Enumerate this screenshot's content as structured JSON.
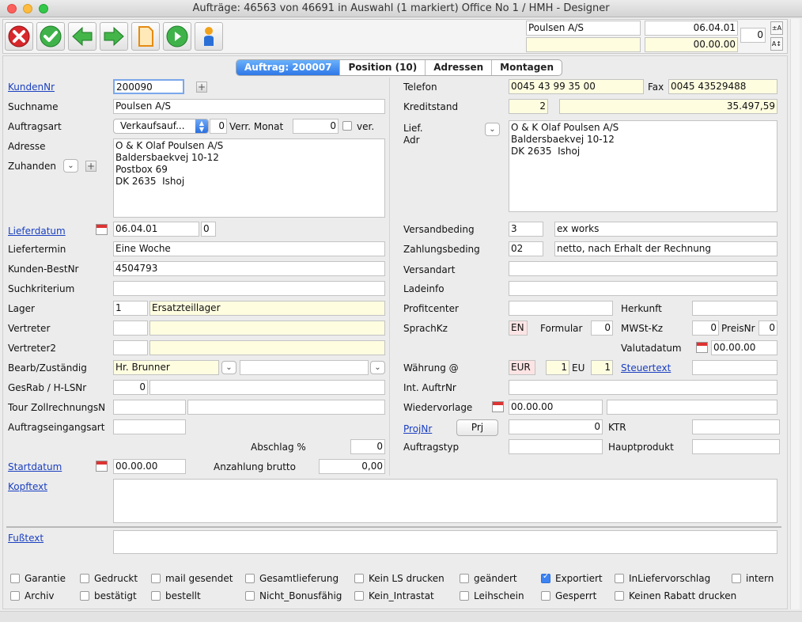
{
  "window": {
    "title": "Aufträge: 46563 von 46691 in Auswahl  (1 markiert) Office No 1 /  HMH - Designer"
  },
  "toolbar": {
    "customer": "Poulsen A/S",
    "date": "06.04.01",
    "amount": "00.00.00",
    "counter": "0",
    "buttons": [
      "cancel-icon",
      "confirm-icon",
      "back-arrow-icon",
      "forward-arrow-icon",
      "document-icon",
      "play-icon",
      "person-icon"
    ]
  },
  "tabs": [
    {
      "label": "Auftrag: 200007"
    },
    {
      "label": "Position (10)"
    },
    {
      "label": "Adressen"
    },
    {
      "label": "Montagen"
    }
  ],
  "left": {
    "kundennr_label": "KundenNr",
    "kundennr": "200090",
    "suchname_label": "Suchname",
    "suchname": "Poulsen A/S",
    "auftragsart_label": "Auftragsart",
    "auftragsart": "Verkaufsauf...",
    "auftragsart_num": "0",
    "verr_monat_label": "Verr. Monat",
    "verr_monat": "0",
    "ver_label": "ver.",
    "adresse_label": "Adresse",
    "zuhanden_label": "Zuhanden",
    "adresse": "O & K Olaf Poulsen A/S\nBaldersbaekvej 10-12\nPostbox 69\nDK 2635  Ishoj",
    "lieferdatum_label": "Lieferdatum",
    "lieferdatum": "06.04.01",
    "lieferdatum_num": "0",
    "liefertermin_label": "Liefertermin",
    "liefertermin": "Eine Woche",
    "bestnr_label": "Kunden-BestNr",
    "bestnr": "4504793",
    "suchkriterium_label": "Suchkriterium",
    "lager_label": "Lager",
    "lager": "1",
    "lager_name": "Ersatzteillager",
    "vertreter_label": "Vertreter",
    "vertreter2_label": "Vertreter2",
    "bearb_label": "Bearb/Zuständig",
    "bearb": "Hr. Brunner",
    "gesrab_label": "GesRab / H-LSNr",
    "gesrab": "0",
    "tour_label": "Tour  ZollrechnungsN",
    "eingangsart_label": "Auftragseingangsart",
    "abschlag_label": "Abschlag %",
    "abschlag": "0",
    "startdatum_label": "Startdatum",
    "startdatum": "00.00.00",
    "anzahlung_label": "Anzahlung brutto",
    "anzahlung": "0,00"
  },
  "right": {
    "telefon_label": "Telefon",
    "telefon": "0045 43 99 35 00",
    "fax_label": "Fax",
    "fax": "0045 43529488",
    "kreditstand_label": "Kreditstand",
    "kreditstand": "2",
    "kredit_betrag": "35.497,59",
    "lief_label": "Lief.",
    "adr_label": "Adr",
    "lief_adresse": "O & K Olaf Poulsen A/S\nBaldersbaekvej 10-12\nDK 2635  Ishoj",
    "versandbeding_label": "Versandbeding",
    "versandbeding": "3",
    "versandbeding_text": "ex works",
    "zahlungsbeding_label": "Zahlungsbeding",
    "zahlungsbeding": "02",
    "zahlungsbeding_text": "netto, nach Erhalt  der Rechnung",
    "versandart_label": "Versandart",
    "ladeinfo_label": "Ladeinfo",
    "profitcenter_label": "Profitcenter",
    "herkunft_label": "Herkunft",
    "sprachkz_label": "SprachKz",
    "sprachkz": "EN",
    "formular_label": "Formular",
    "formular": "0",
    "mwst_label": "MWSt-Kz",
    "mwst": "0",
    "preisnr_label": "PreisNr",
    "preisnr": "0",
    "valutadatum_label": "Valutadatum",
    "valutadatum": "00.00.00",
    "waehrung_label": "Währung @",
    "waehrung": "EUR",
    "waehrung_num": "1",
    "eu_label": "EU",
    "eu": "1",
    "steuertext_label": "Steuertext",
    "int_auftrnr_label": "Int. AuftrNr",
    "wiedervorlage_label": "Wiedervorlage",
    "wiedervorlage": "00.00.00",
    "projnr_label": "ProjNr",
    "prj_button": "Prj",
    "projnr": "0",
    "ktr_label": "KTR",
    "auftragstyp_label": "Auftragstyp",
    "hauptprodukt_label": "Hauptprodukt"
  },
  "kopftext_label": "Kopftext",
  "fusstext_label": "Fußtext",
  "checkboxes_row1": [
    {
      "label": "Garantie",
      "checked": false
    },
    {
      "label": "Gedruckt",
      "checked": false
    },
    {
      "label": "mail gesendet",
      "checked": false
    },
    {
      "label": "Gesamtlieferung",
      "checked": false
    },
    {
      "label": "Kein LS drucken",
      "checked": false
    },
    {
      "label": "geändert",
      "checked": false
    },
    {
      "label": "Exportiert",
      "checked": true
    },
    {
      "label": "InLiefervorschlag",
      "checked": false
    },
    {
      "label": "intern",
      "checked": false
    }
  ],
  "checkboxes_row2": [
    {
      "label": "Archiv",
      "checked": false
    },
    {
      "label": "bestätigt",
      "checked": false
    },
    {
      "label": "bestellt",
      "checked": false
    },
    {
      "label": "Nicht_Bonusfähig",
      "checked": false
    },
    {
      "label": "Kein_Intrastat",
      "checked": false
    },
    {
      "label": "Leihschein",
      "checked": false
    },
    {
      "label": "Gesperrt",
      "checked": false
    },
    {
      "label": "Keinen Rabatt drucken",
      "checked": false
    }
  ],
  "colors": {
    "accent": "#2e78e8",
    "link": "#1a3fc0",
    "highlight_yellow": "#fefde0"
  }
}
